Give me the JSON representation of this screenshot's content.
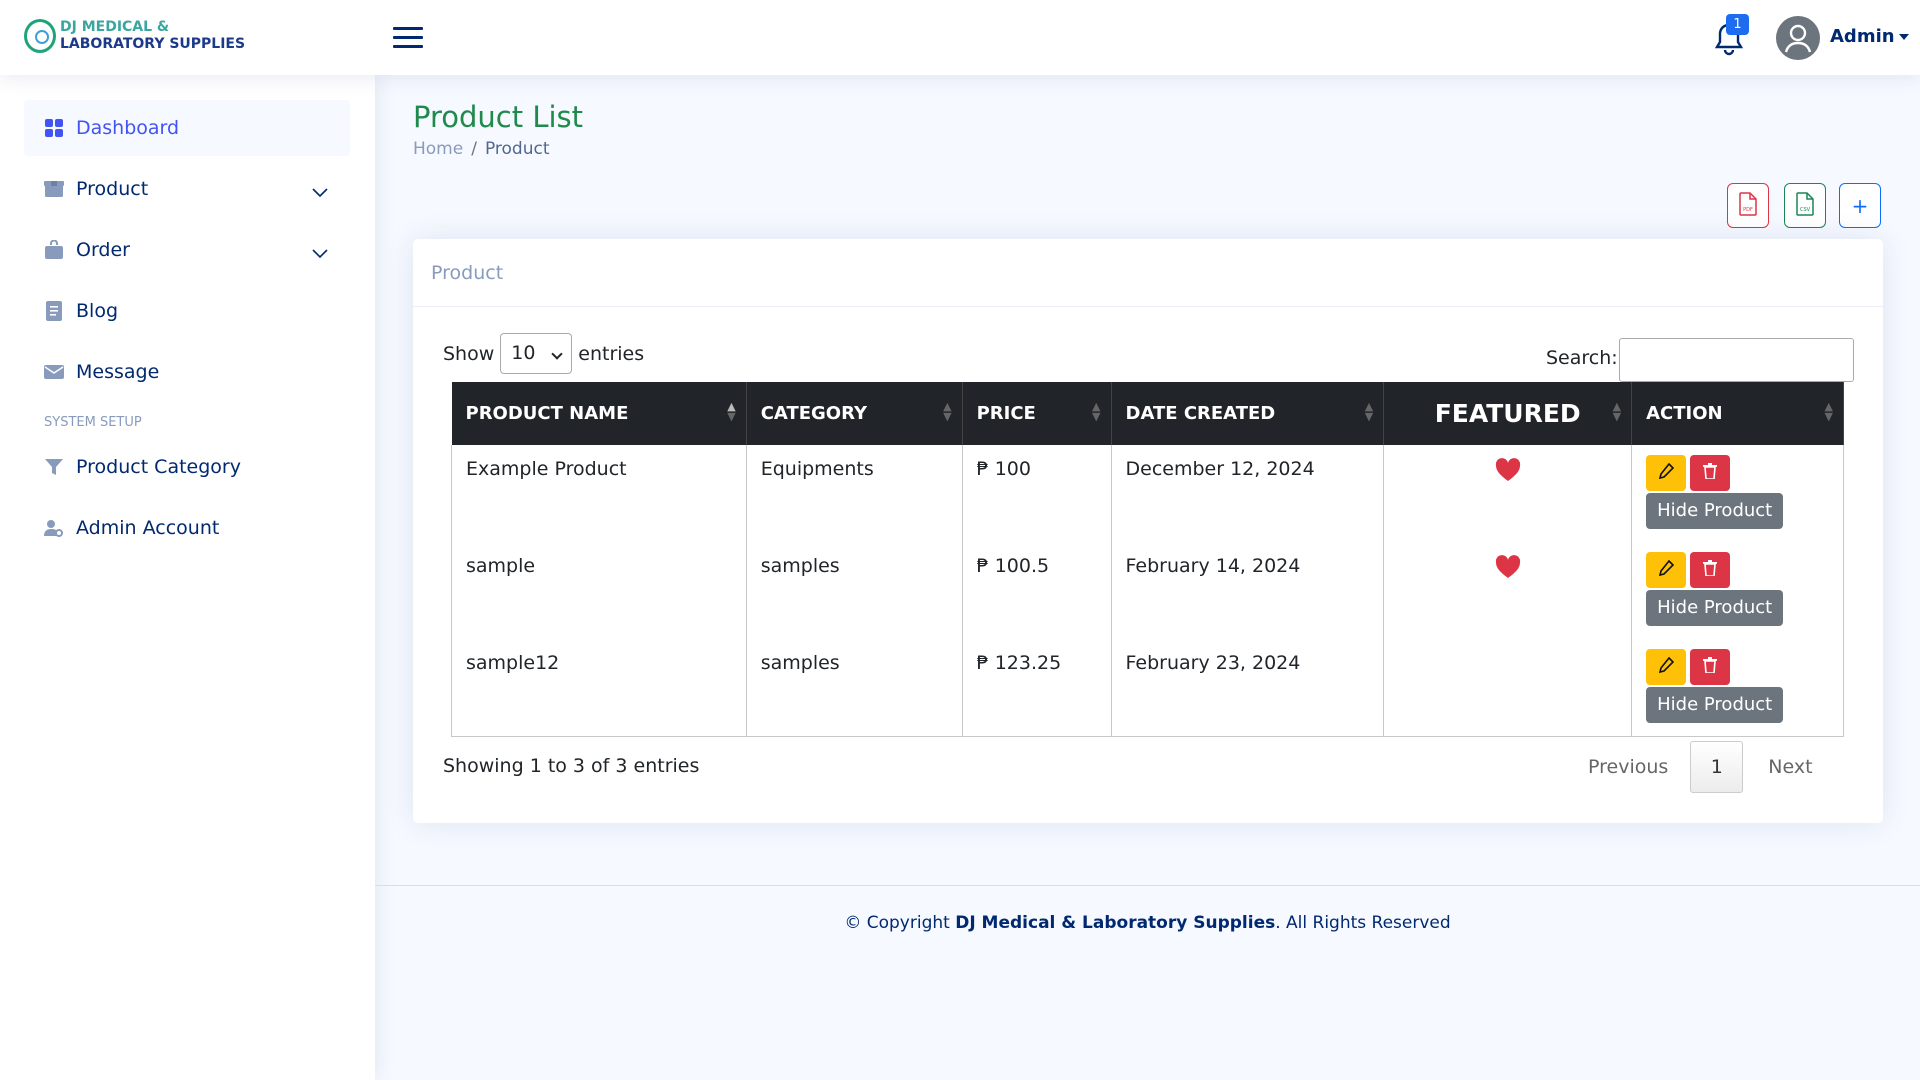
{
  "brand": {
    "line1": "DJ MEDICAL &",
    "line2": "LABORATORY SUPPLIES"
  },
  "header": {
    "notification_count": "1",
    "user": "Admin"
  },
  "sidebar": {
    "items": [
      {
        "label": "Dashboard",
        "icon": "grid-icon"
      },
      {
        "label": "Product",
        "icon": "box-icon"
      },
      {
        "label": "Order",
        "icon": "bag-icon"
      },
      {
        "label": "Blog",
        "icon": "document-icon"
      },
      {
        "label": "Message",
        "icon": "envelope-icon"
      }
    ],
    "section_heading": "SYSTEM SETUP",
    "setup_items": [
      {
        "label": "Product Category",
        "icon": "funnel-icon"
      },
      {
        "label": "Admin Account",
        "icon": "user-gear-icon"
      }
    ]
  },
  "page": {
    "title": "Product List",
    "breadcrumb": [
      "Home",
      "Product"
    ]
  },
  "toolbar": {
    "pdf_icon": "pdf-file-icon",
    "csv_icon": "csv-file-icon",
    "add_label": "+"
  },
  "card": {
    "title": "Product",
    "show_prefix": "Show",
    "entries_value": "10",
    "show_suffix": "entries",
    "search_label": "Search:",
    "columns": [
      "PRODUCT NAME",
      "CATEGORY",
      "PRICE",
      "DATE CREATED",
      "FEATURED",
      "ACTION"
    ],
    "rows": [
      {
        "name": "Example Product",
        "category": "Equipments",
        "price": "₱ 100",
        "date": "December 12, 2024",
        "featured": true,
        "hide_label": "Hide Product"
      },
      {
        "name": "sample",
        "category": "samples",
        "price": "₱ 100.5",
        "date": "February 14, 2024",
        "featured": true,
        "hide_label": "Hide Product"
      },
      {
        "name": "sample12",
        "category": "samples",
        "price": "₱ 123.25",
        "date": "February 23, 2024",
        "featured": false,
        "hide_label": "Hide Product"
      }
    ],
    "info": "Showing 1 to 3 of 3 entries",
    "pager": {
      "prev": "Previous",
      "page": "1",
      "next": "Next"
    }
  },
  "footer": {
    "prefix": "© Copyright ",
    "company": "DJ Medical & Laboratory Supplies",
    "suffix": ". All Rights Reserved"
  },
  "colors": {
    "accent": "#4154f1",
    "title_green": "#1f8a4c",
    "edit_yellow": "#ffc107",
    "delete_red": "#dc3545",
    "hide_gray": "#6c757d"
  }
}
